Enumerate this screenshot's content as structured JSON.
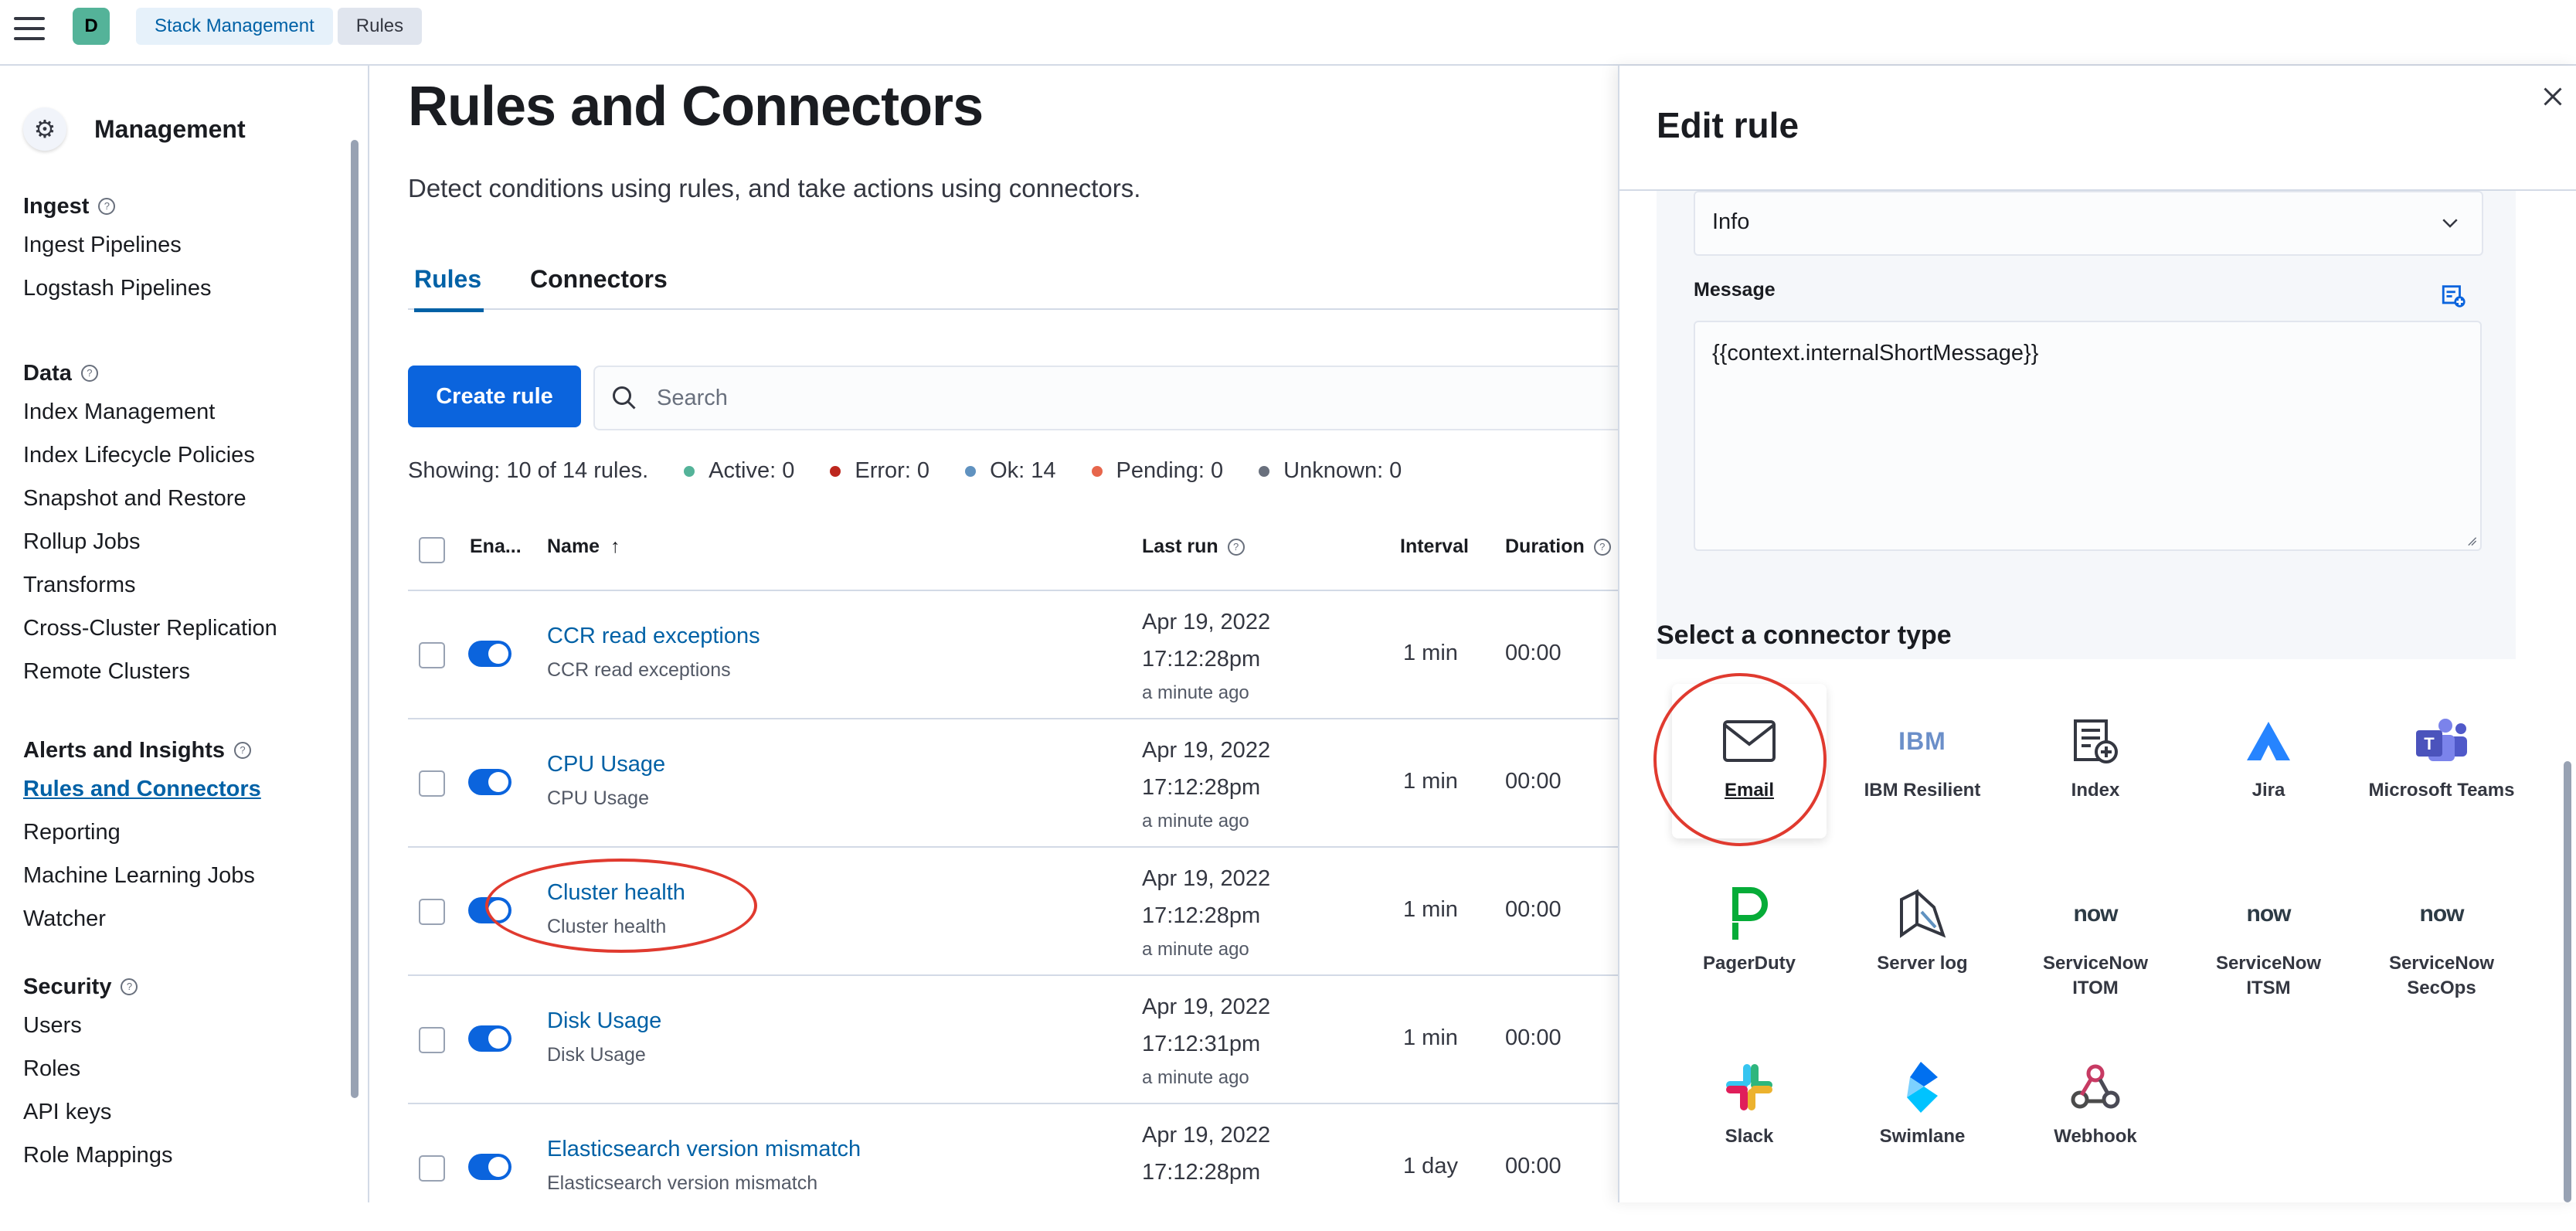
{
  "header": {
    "avatar_letter": "D",
    "breadcrumbs": [
      "Stack Management",
      "Rules"
    ]
  },
  "sidebar": {
    "title": "Management",
    "groups": [
      {
        "title": "Ingest",
        "items": [
          "Ingest Pipelines",
          "Logstash Pipelines"
        ]
      },
      {
        "title": "Data",
        "items": [
          "Index Management",
          "Index Lifecycle Policies",
          "Snapshot and Restore",
          "Rollup Jobs",
          "Transforms",
          "Cross-Cluster Replication",
          "Remote Clusters"
        ]
      },
      {
        "title": "Alerts and Insights",
        "items": [
          "Rules and Connectors",
          "Reporting",
          "Machine Learning Jobs",
          "Watcher"
        ]
      },
      {
        "title": "Security",
        "items": [
          "Users",
          "Roles",
          "API keys",
          "Role Mappings"
        ]
      }
    ]
  },
  "main": {
    "title": "Rules and Connectors",
    "description": "Detect conditions using rules, and take actions using connectors.",
    "tabs": [
      "Rules",
      "Connectors"
    ],
    "create_button": "Create rule",
    "search_placeholder": "Search",
    "showing": "Showing: 10 of 14 rules.",
    "stats": [
      {
        "label": "Active: 0",
        "color": "#54b399"
      },
      {
        "label": "Error: 0",
        "color": "#bd271e"
      },
      {
        "label": "Ok: 14",
        "color": "#6092c0"
      },
      {
        "label": "Pending: 0",
        "color": "#e7664c"
      },
      {
        "label": "Unknown: 0",
        "color": "#69707d"
      }
    ],
    "columns": {
      "enabled": "Ena...",
      "name": "Name",
      "last_run": "Last run",
      "interval": "Interval",
      "duration": "Duration"
    },
    "rows": [
      {
        "name": "CCR read exceptions",
        "sub": "CCR read exceptions",
        "date": "Apr 19, 2022",
        "time": "17:12:28pm",
        "ago": "a minute ago",
        "interval": "1 min",
        "duration": "00:00"
      },
      {
        "name": "CPU Usage",
        "sub": "CPU Usage",
        "date": "Apr 19, 2022",
        "time": "17:12:28pm",
        "ago": "a minute ago",
        "interval": "1 min",
        "duration": "00:00"
      },
      {
        "name": "Cluster health",
        "sub": "Cluster health",
        "date": "Apr 19, 2022",
        "time": "17:12:28pm",
        "ago": "a minute ago",
        "interval": "1 min",
        "duration": "00:00"
      },
      {
        "name": "Disk Usage",
        "sub": "Disk Usage",
        "date": "Apr 19, 2022",
        "time": "17:12:31pm",
        "ago": "a minute ago",
        "interval": "1 min",
        "duration": "00:00"
      },
      {
        "name": "Elasticsearch version mismatch",
        "sub": "Elasticsearch version mismatch",
        "date": "Apr 19, 2022",
        "time": "17:12:28pm",
        "ago": "",
        "interval": "1 day",
        "duration": "00:00"
      }
    ]
  },
  "flyout": {
    "title": "Edit rule",
    "select_value": "Info",
    "message_label": "Message",
    "message_value": "{{context.internalShortMessage}}",
    "section_title": "Select a connector type",
    "connectors": [
      {
        "label": "Email",
        "icon": "mail-icon"
      },
      {
        "label": "IBM Resilient",
        "icon": "ibm-icon"
      },
      {
        "label": "Index",
        "icon": "index-icon"
      },
      {
        "label": "Jira",
        "icon": "jira-icon"
      },
      {
        "label": "Microsoft Teams",
        "icon": "teams-icon"
      },
      {
        "label": "PagerDuty",
        "icon": "pagerduty-icon"
      },
      {
        "label": "Server log",
        "icon": "server-log-icon"
      },
      {
        "label": "ServiceNow ITOM",
        "icon": "servicenow-icon"
      },
      {
        "label": "ServiceNow ITSM",
        "icon": "servicenow-icon"
      },
      {
        "label": "ServiceNow SecOps",
        "icon": "servicenow-icon"
      },
      {
        "label": "Slack",
        "icon": "slack-icon"
      },
      {
        "label": "Swimlane",
        "icon": "swimlane-icon"
      },
      {
        "label": "Webhook",
        "icon": "webhook-icon"
      }
    ],
    "servicenow_logo_text": "now",
    "ibm_logo_text": "IBM",
    "teams_logo_text": "T"
  }
}
